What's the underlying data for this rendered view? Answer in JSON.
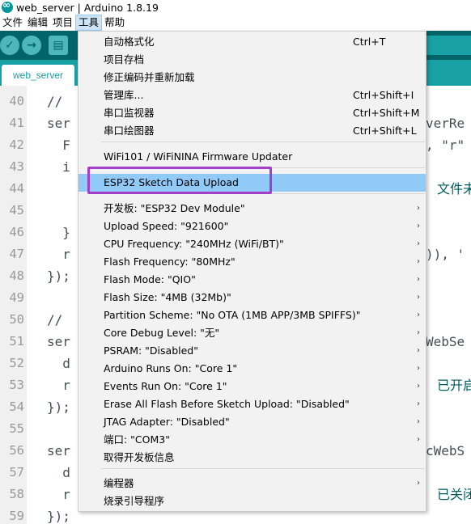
{
  "window": {
    "title": "web_server | Arduino 1.8.19"
  },
  "menubar": {
    "items": [
      "文件",
      "编辑",
      "项目",
      "工具",
      "帮助"
    ],
    "active": "工具"
  },
  "toolbar": {
    "verify": "✓",
    "upload": "→",
    "new": "▤"
  },
  "tab": {
    "label": "web_server"
  },
  "editor": {
    "lines": [
      {
        "num": "40",
        "code": "//",
        "right": ""
      },
      {
        "num": "41",
        "code": "ser",
        "right": "verRe"
      },
      {
        "num": "42",
        "code": "  F",
        "right": ", \"r\""
      },
      {
        "num": "43",
        "code": "  i",
        "right": ""
      },
      {
        "num": "44",
        "code": "",
        "right": "文件未找"
      },
      {
        "num": "45",
        "code": "",
        "right": ""
      },
      {
        "num": "46",
        "code": "  }",
        "right": ""
      },
      {
        "num": "47",
        "code": "  r",
        "right": ")), '"
      },
      {
        "num": "48",
        "code": "});",
        "right": ""
      },
      {
        "num": "49",
        "code": "",
        "right": ""
      },
      {
        "num": "50",
        "code": "//",
        "right": ""
      },
      {
        "num": "51",
        "code": "ser",
        "right": "WebSe"
      },
      {
        "num": "52",
        "code": "  d",
        "right": ""
      },
      {
        "num": "53",
        "code": "  r",
        "right": "已开启"
      },
      {
        "num": "54",
        "code": "});",
        "right": ""
      },
      {
        "num": "55",
        "code": "",
        "right": ""
      },
      {
        "num": "56",
        "code": "ser",
        "right": "cWebS"
      },
      {
        "num": "57",
        "code": "  d",
        "right": ""
      },
      {
        "num": "58",
        "code": "  r",
        "right": "已关闭"
      },
      {
        "num": "59",
        "code": "});",
        "right": ""
      }
    ]
  },
  "tools_menu": {
    "items": [
      {
        "label": "自动格式化",
        "shortcut": "Ctrl+T"
      },
      {
        "label": "项目存档",
        "shortcut": ""
      },
      {
        "label": "修正编码并重新加载",
        "shortcut": ""
      },
      {
        "label": "管理库...",
        "shortcut": "Ctrl+Shift+I"
      },
      {
        "label": "串口监视器",
        "shortcut": "Ctrl+Shift+M"
      },
      {
        "label": "串口绘图器",
        "shortcut": "Ctrl+Shift+L"
      },
      {
        "label": "WiFi101 / WiFiNINA Firmware Updater",
        "shortcut": ""
      },
      {
        "label": "ESP32 Sketch Data Upload",
        "shortcut": ""
      },
      {
        "label": "开发板: \"ESP32 Dev Module\"",
        "shortcut": ""
      },
      {
        "label": "Upload Speed: \"921600\"",
        "shortcut": ""
      },
      {
        "label": "CPU Frequency: \"240MHz (WiFi/BT)\"",
        "shortcut": ""
      },
      {
        "label": "Flash Frequency: \"80MHz\"",
        "shortcut": ""
      },
      {
        "label": "Flash Mode: \"QIO\"",
        "shortcut": ""
      },
      {
        "label": "Flash Size: \"4MB (32Mb)\"",
        "shortcut": ""
      },
      {
        "label": "Partition Scheme: \"No OTA (1MB APP/3MB SPIFFS)\"",
        "shortcut": ""
      },
      {
        "label": "Core Debug Level: \"无\"",
        "shortcut": ""
      },
      {
        "label": "PSRAM: \"Disabled\"",
        "shortcut": ""
      },
      {
        "label": "Arduino Runs On: \"Core 1\"",
        "shortcut": ""
      },
      {
        "label": "Events Run On: \"Core 1\"",
        "shortcut": ""
      },
      {
        "label": "Erase All Flash Before Sketch Upload: \"Disabled\"",
        "shortcut": ""
      },
      {
        "label": "JTAG Adapter: \"Disabled\"",
        "shortcut": ""
      },
      {
        "label": "端口: \"COM3\"",
        "shortcut": ""
      },
      {
        "label": "取得开发板信息",
        "shortcut": ""
      },
      {
        "label": "编程器",
        "shortcut": ""
      },
      {
        "label": "烧录引导程序",
        "shortcut": ""
      }
    ],
    "highlighted": "ESP32 Sketch Data Upload"
  },
  "colors": {
    "toolbar": "#006468",
    "tabstrip": "#17a1a5",
    "menu_highlight": "#91c9f7",
    "annotation_box": "#a33ec8"
  }
}
